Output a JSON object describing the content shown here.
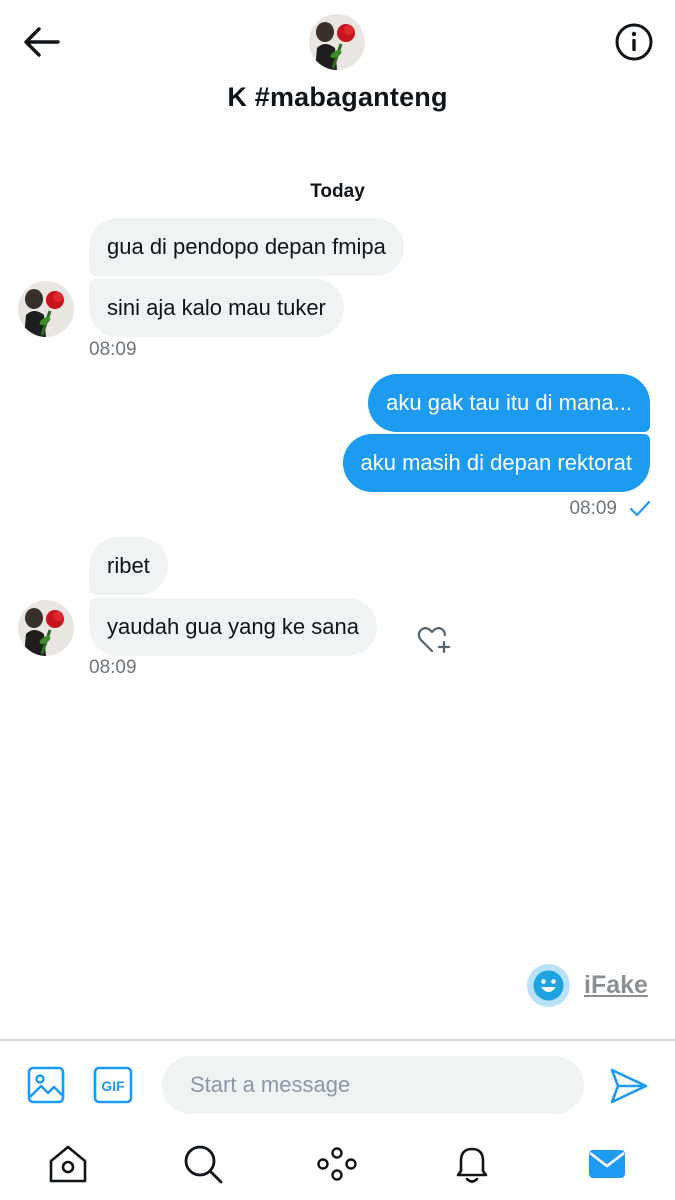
{
  "header": {
    "contact_name": "K #mabaganteng",
    "back_icon": "arrow-left-icon",
    "info_icon": "info-circle-icon"
  },
  "conversation": {
    "day_label": "Today",
    "groups": [
      {
        "direction": "incoming",
        "messages": [
          "gua di pendopo depan fmipa",
          "sini aja kalo mau tuker"
        ],
        "time": "08:09"
      },
      {
        "direction": "outgoing",
        "messages": [
          "aku gak tau itu di mana...",
          "aku masih di depan rektorat"
        ],
        "time": "08:09",
        "status_icon": "check-icon"
      },
      {
        "direction": "incoming",
        "messages": [
          "ribet",
          "yaudah gua yang ke sana"
        ],
        "time": "08:09",
        "reaction_icon": "heart-add-icon"
      }
    ]
  },
  "watermark": {
    "text": "iFake"
  },
  "composer": {
    "placeholder": "Start a message",
    "gif_label": "GIF"
  },
  "bottom_nav": [
    "home-icon",
    "search-icon",
    "spaces-icon",
    "bell-icon",
    "mail-icon"
  ],
  "colors": {
    "accent": "#1d9bf0",
    "incoming_bubble": "#eff3f4",
    "timestamp": "#6e767d",
    "text": "#0f1419"
  }
}
